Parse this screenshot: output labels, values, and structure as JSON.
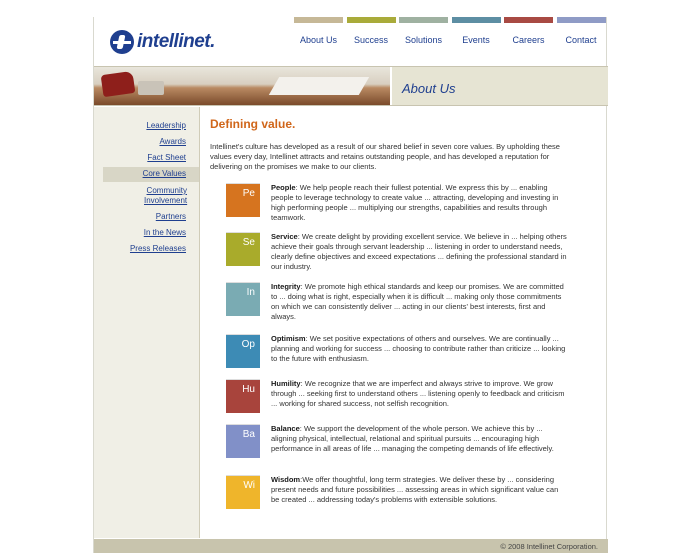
{
  "brand": {
    "name": "intellinet.",
    "color": "#1f3f8f"
  },
  "nav": [
    {
      "label": "About Us",
      "bar_color": "#c6b897"
    },
    {
      "label": "Success",
      "bar_color": "#a9ab3a"
    },
    {
      "label": "Solutions",
      "bar_color": "#9fb1a1"
    },
    {
      "label": "Events",
      "bar_color": "#5d8ea3"
    },
    {
      "label": "Careers",
      "bar_color": "#a84a43"
    },
    {
      "label": "Contact",
      "bar_color": "#8f9bc6"
    }
  ],
  "banner": {
    "title": "About Us"
  },
  "sidebar": {
    "items": [
      {
        "label": "Leadership",
        "active": false
      },
      {
        "label": "Awards",
        "active": false
      },
      {
        "label": "Fact Sheet",
        "active": false
      },
      {
        "label": "Core Values",
        "active": true
      },
      {
        "label": "Community Involvement",
        "active": false
      },
      {
        "label": "Partners",
        "active": false
      },
      {
        "label": "In the News",
        "active": false
      },
      {
        "label": "Press Releases",
        "active": false
      }
    ]
  },
  "main": {
    "heading": "Defining value.",
    "intro": "Intellinet's culture has developed as a result of our shared belief in seven core values. By upholding these values every day, Intellinet attracts and retains outstanding people, and has developed a reputation for delivering on the promises we make to our clients.",
    "values": [
      {
        "abbr": "Pe",
        "color": "#d6741f",
        "name": "People",
        "sep": ":",
        "text": " We help people reach their fullest potential. We express this by ... enabling people to leverage technology to create value ... attracting, developing and investing in high performing people ... multiplying our strengths, capabilities and results through teamwork."
      },
      {
        "abbr": "Se",
        "color": "#a9ab2b",
        "name": "Service",
        "sep": ":",
        "text": " We create delight by providing excellent service. We believe in ... helping others achieve their goals through servant leadership ... listening in order to understand needs, clearly define objectives and exceed expectations ... defining the professional standard in our industry."
      },
      {
        "abbr": "In",
        "color": "#7aabb3",
        "name": "Integrity",
        "sep": ":",
        "text": " We promote high ethical standards and keep our promises. We are committed to ... doing what is right, especially when it is difficult ... making only those commitments on which we can consistently deliver ... acting in our clients' best interests, first and always."
      },
      {
        "abbr": "Op",
        "color": "#3d8bb5",
        "name": "Optimism",
        "sep": ":",
        "text": " We set positive expectations of others and ourselves. We are continually ... planning and working for success ... choosing to contribute rather than criticize ... looking to the future with enthusiasm."
      },
      {
        "abbr": "Hu",
        "color": "#a8443c",
        "name": "Humility",
        "sep": ":",
        "text": " We recognize that we are imperfect and always strive to improve. We grow through ... seeking first to understand others ... listening openly to feedback and criticism ... working for shared success, not selfish recognition."
      },
      {
        "abbr": "Ba",
        "color": "#8190c8",
        "name": "Balance",
        "sep": ":",
        "text": " We support the development of the whole person. We achieve this by ... aligning physical, intellectual, relational and spiritual pursuits ... encouraging high performance in all areas of life ... managing the competing demands of life effectively."
      },
      {
        "abbr": "Wi",
        "color": "#efb52b",
        "name": "Wisdom",
        "sep": ":",
        "text": "We offer thoughtful, long term strategies. We deliver these by ... considering present needs and future possibilities ... assessing areas in which significant value can be created ... addressing today's problems with extensible solutions."
      }
    ]
  },
  "footer": {
    "copyright": "© 2008 Intellinet Corporation."
  }
}
